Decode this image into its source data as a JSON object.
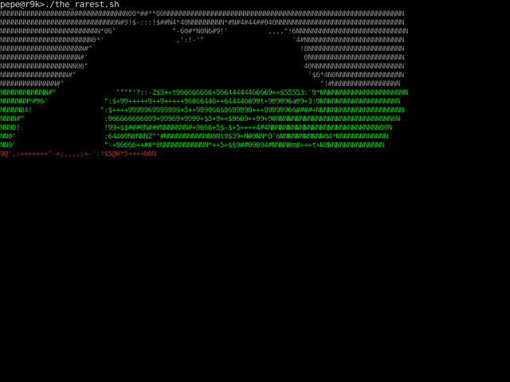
{
  "terminal": {
    "prompt": "pepe@r9k>./the_rarest.sh",
    "lines": [
      "NNNNNNNNNNNNNNNNNNNNNNNNNNNNNNNN00*##**00NNNNNNNNNNNNNNNNNNNNNNNNNNNNNNNNNNNNNNNNNNNNNNNNNNNNNNNNNNNN",
      "NNNNNNNNNNNNNNNNNNNNNNNNNNNN0N#9!$-:::!$##N4*40NNNNNNNNN*#N#4#44##040NNNNNNNNNNNNNNNNNNNNNNNNNNNNNNNN",
      "NNNNNNNNNNNNNNNNNNNNNNNNN*06\"              \"-60#*N0N6#9!'          ,,,,\"!6NNNNNNNNNNNNNNNNNNNNNNNNNNNN",
      "NNNNNNNNNNNNNNNNNNNNNNN0*'                  ,':!-'\"                      '4#NNNNNNNNNNNNNNNNNNNNNNNNN",
      "NNNNNNNNNNNNNNNNNNNNN#^                                                    !8NNNNNNNNNNNNNNNNNNNNNNNN",
      "NNNNNNNNNNNNNNNNNNNN#'                                                      0NNNNNNNNNNNNNNNNNNNNNNNN",
      "NNNNNNNNNNNNNNNNNNN06\"                                                      40NNNNNNNNNNNNNNNNNNNNNNN",
      "NNNNNNNNNNNNNNNNN#\"                                                          '$6*4N0NNNNNNNNNNNNNNNNN",
      "NNNNNNNNNNNNNN#\"                                                                \"!#NNNNNNNNNNNNNNNNN",
      "NNNNNNNNNNNN#\"               \"\"\"\"'?::-Z$5++t966666666+56644444466669++$55553:'9*NNNNNNNNNNNNNNNNNNNNNN",
      "NNNNNNN*#96'              \":$+99+++++9++9+++++96666446++644446699t+999996a99+3:0NNNNNNNNNNNNNNNNNNNN",
      "NNNNN04!                 \":$++++9999969999999+5++999966$9699999+++99999966####+NNNNNNNNNNNNNNNNNNNNNN",
      "NNNN#\"                    :966666666699+99969+9999+$5+9+<$9669++99+90NNNNNNNNNNNNNNNNNNNNNNNNNNNNN0N",
      "NNN0!                     !99+$$###0N###NNNNNNN#+9666+5$-$+5++++4#4NNNNNNNNNNNNNNNNNNNNNNNNNNNN00N",
      "NN0'                      :64469N0NNNZ^'#NNNNNNNNNNNN0Nt9$39+N#0NN*D'6NNNNNNNNNNN04*NNNNNNNNNNNNN",
      "NN0'                      \"-+96666++##*0NNNNNNNNNNNN*++5+$$9##00004#NNNN0m#+++t+N8NNNNNNNNNNNNNN",
      "0@',:+++++++\"-+;,,,,;+-':!$5@0*5++++N0N"
    ]
  }
}
